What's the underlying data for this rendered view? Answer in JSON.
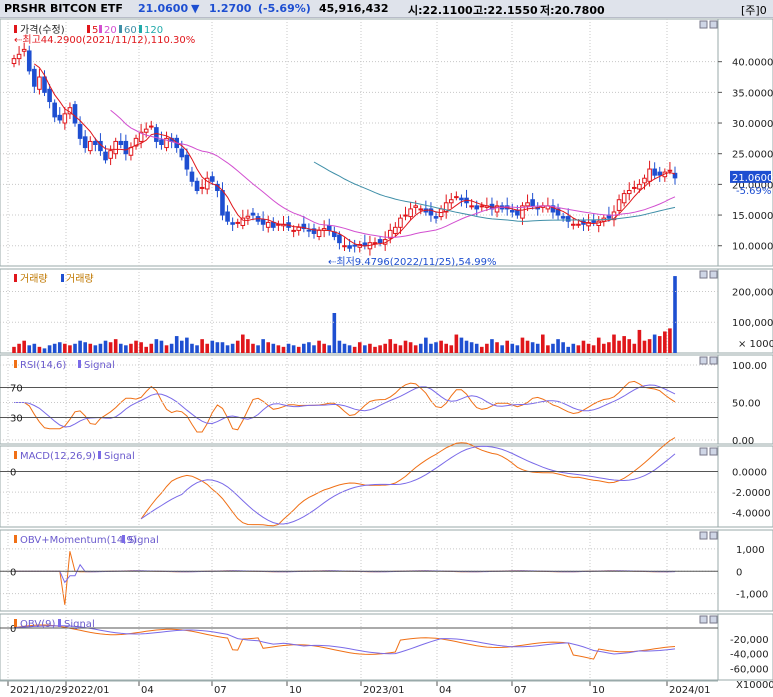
{
  "header": {
    "name": "PRSHR BITCON ETF",
    "price": "21.0600",
    "change_arrow": "▼",
    "change": "1.2700",
    "change_pct": "(-5.69%)",
    "volume": "45,916,432",
    "open_label": "시:22.1100",
    "high_label": "고:22.1550",
    "low_label": "저:20.7800",
    "period": "[주]0"
  },
  "panels": {
    "price": {
      "legend": [
        "가격(수정)",
        "5",
        "20",
        "60",
        "120"
      ],
      "max_note": "최고44.2900(2021/11/12),110.30%",
      "min_note": "최저9.4796(2022/11/25),54.99%",
      "last_price_tag": "21.0600",
      "last_pct_tag": "-5.69%",
      "y_ticks": [
        "40.0000",
        "35.0000",
        "30.0000",
        "25.0000",
        "20.0000",
        "15.0000",
        "10.0000"
      ]
    },
    "volume": {
      "legend": [
        "거래량",
        "거래량"
      ],
      "y_ticks": [
        "200,000",
        "100,000"
      ],
      "unit": "× 1000"
    },
    "rsi": {
      "legend": [
        "RSI(14,6)",
        "Signal"
      ],
      "levels": [
        "70",
        "30"
      ],
      "y_ticks": [
        "100.00",
        "50.00",
        "0.00"
      ]
    },
    "macd": {
      "legend": [
        "MACD(12,26,9)",
        "Signal"
      ],
      "zero_label": "0",
      "y_ticks": [
        "0.0000",
        "-2.0000",
        "-4.0000"
      ]
    },
    "obv_mom": {
      "legend": [
        "OBV+Momentum(14,9)",
        "Signal"
      ],
      "zero_label": "0",
      "y_ticks": [
        "1,000",
        "0",
        "-1,000"
      ]
    },
    "obv": {
      "legend": [
        "OBV(9)",
        "Signal"
      ],
      "zero_label": "0",
      "y_ticks": [
        "-20,000",
        "-40,000",
        "-60,000"
      ],
      "unit": "X10000"
    }
  },
  "x_axis": [
    "2021/10/29",
    "2022/01",
    "04",
    "07",
    "10",
    "2023/01",
    "04",
    "07",
    "10",
    "2024/01"
  ],
  "colors": {
    "up": "#e0161b",
    "down": "#1e4fd1",
    "ma5": "#e0161b",
    "ma20": "#d24fd0",
    "ma60": "#3f8fa8",
    "grid": "#c8c8c8",
    "osc": "#f07016",
    "signal": "#7a6ae8"
  },
  "chart_data": {
    "type": "candlestick",
    "interval": "weekly",
    "title": "PRSHR BITCON ETF",
    "last": {
      "price": 21.06,
      "change": -1.27,
      "change_pct": -5.69,
      "open": 22.11,
      "high": 22.155,
      "low": 20.78,
      "volume": 45916432
    },
    "high_point": {
      "value": 44.29,
      "date": "2021/11/12",
      "pct": 110.3
    },
    "low_point": {
      "value": 9.4796,
      "date": "2022/11/25",
      "pct": 54.99
    },
    "price_ylim": [
      8,
      45
    ],
    "close_series": [
      40.5,
      41.2,
      42.0,
      38.5,
      36.0,
      37.5,
      35.0,
      33.5,
      31.0,
      30.5,
      31.5,
      32.5,
      30.0,
      27.5,
      26.0,
      27.0,
      26.5,
      25.5,
      24.0,
      25.5,
      27.0,
      26.5,
      25.0,
      26.0,
      27.5,
      28.5,
      29.0,
      29.5,
      27.0,
      26.5,
      27.5,
      27.0,
      26.0,
      24.5,
      22.5,
      20.5,
      19.0,
      19.5,
      21.0,
      20.5,
      19.0,
      15.0,
      14.0,
      13.5,
      13.8,
      14.5,
      14.8,
      15.0,
      14.0,
      13.5,
      13.8,
      13.0,
      13.5,
      13.5,
      13.0,
      12.5,
      13.0,
      12.8,
      12.5,
      12.0,
      12.5,
      12.8,
      12.5,
      11.5,
      10.5,
      10.0,
      9.6,
      10.0,
      10.2,
      10.0,
      10.5,
      10.5,
      10.5,
      11.0,
      12.5,
      13.0,
      14.5,
      15.0,
      16.0,
      16.5,
      16.0,
      15.5,
      15.0,
      14.5,
      16.0,
      17.0,
      17.5,
      18.0,
      17.5,
      17.0,
      16.5,
      16.0,
      16.5,
      16.5,
      16.0,
      16.5,
      16.0,
      16.0,
      15.5,
      15.0,
      16.5,
      17.0,
      16.5,
      16.0,
      16.5,
      16.5,
      15.5,
      15.0,
      14.5,
      14.0,
      13.5,
      13.5,
      13.5,
      13.8,
      13.8,
      14.0,
      14.5,
      14.5,
      15.5,
      17.5,
      18.5,
      19.0,
      19.5,
      20.0,
      21.0,
      22.5,
      21.5,
      21.5,
      22.0,
      22.3,
      21.06
    ],
    "volume_series": [
      20,
      30,
      40,
      25,
      30,
      20,
      15,
      25,
      30,
      35,
      30,
      25,
      30,
      40,
      35,
      30,
      25,
      30,
      40,
      35,
      45,
      30,
      25,
      30,
      40,
      35,
      20,
      30,
      45,
      40,
      25,
      30,
      55,
      40,
      50,
      30,
      25,
      45,
      30,
      40,
      35,
      35,
      25,
      30,
      40,
      60,
      45,
      30,
      25,
      45,
      35,
      30,
      25,
      20,
      30,
      25,
      20,
      30,
      35,
      25,
      40,
      30,
      25,
      130,
      40,
      30,
      25,
      20,
      35,
      25,
      30,
      20,
      25,
      30,
      45,
      30,
      25,
      40,
      35,
      25,
      30,
      50,
      30,
      35,
      40,
      30,
      25,
      60,
      50,
      40,
      35,
      30,
      20,
      30,
      45,
      35,
      25,
      40,
      30,
      25,
      50,
      40,
      35,
      30,
      60,
      25,
      30,
      45,
      35,
      20,
      30,
      25,
      40,
      30,
      25,
      50,
      30,
      35,
      60,
      40,
      55,
      45,
      30,
      75,
      40,
      45,
      60,
      55,
      70,
      80,
      250
    ],
    "rsi_ylim": [
      0,
      100
    ],
    "rsi_levels": [
      70,
      30
    ],
    "macd_ylim": [
      -5,
      1.5
    ],
    "obv_mom_ylim": [
      -1600,
      1400
    ],
    "obv_ylim": [
      -70,
      0
    ]
  }
}
